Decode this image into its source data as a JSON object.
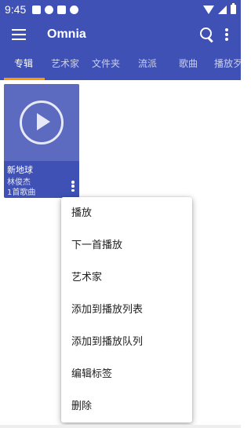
{
  "status_bar": {
    "time": "9:45",
    "icons": [
      "grid-icon",
      "alert-icon",
      "a-icon",
      "pause-circle-icon",
      "wifi-icon",
      "signal-icon",
      "battery-icon"
    ]
  },
  "toolbar": {
    "title": "Omnia",
    "icons": [
      "menu-icon",
      "search-icon",
      "more-vert-icon"
    ]
  },
  "tabs": [
    {
      "label": "专辑",
      "active": true
    },
    {
      "label": "艺术家",
      "active": false
    },
    {
      "label": "文件夹",
      "active": false
    },
    {
      "label": "流派",
      "active": false
    },
    {
      "label": "歌曲",
      "active": false
    },
    {
      "label": "播放歹",
      "active": false
    }
  ],
  "album": {
    "title": "新地球",
    "artist": "林俊杰",
    "count": "1首歌曲"
  },
  "context_menu": [
    "播放",
    "下一首播放",
    "艺术家",
    "添加到播放列表",
    "添加到播放队列",
    "编辑标签",
    "删除"
  ],
  "colors": {
    "primary": "#3f51b5",
    "album_art": "#5c6bc0",
    "tab_indicator": "#ff9800"
  }
}
